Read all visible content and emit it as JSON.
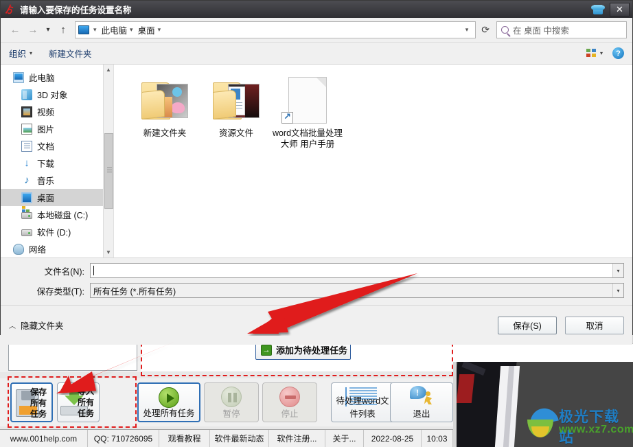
{
  "dialog": {
    "title": "请输入要保存的任务设置名称",
    "close_label": "✕",
    "titlebar_icon": "app-icon",
    "shirt_icon": "shirt-icon"
  },
  "nav": {
    "back_icon": "←",
    "forward_icon": "→",
    "recent_icon": "▾",
    "up_icon": "↑",
    "refresh_icon": "⟳",
    "address": {
      "pc_icon": "computer-icon",
      "crumbs": [
        "此电脑",
        "桌面"
      ],
      "dropdown_icon": "▾"
    },
    "search": {
      "placeholder": "在 桌面 中搜索",
      "icon": "search-icon"
    }
  },
  "command_bar": {
    "organize": "组织",
    "new_folder": "新建文件夹",
    "caret": "▾",
    "view_icon": "view-layout-icon",
    "help_icon": "?"
  },
  "sidebar": {
    "items": [
      {
        "label": "此电脑",
        "icon": "pc",
        "level": 1,
        "state": ""
      },
      {
        "label": "3D 对象",
        "icon": "d3",
        "level": 2,
        "state": ""
      },
      {
        "label": "视频",
        "icon": "vid",
        "level": 2,
        "state": ""
      },
      {
        "label": "图片",
        "icon": "pic",
        "level": 2,
        "state": ""
      },
      {
        "label": "文档",
        "icon": "doc",
        "level": 2,
        "state": ""
      },
      {
        "label": "下载",
        "icon": "dl",
        "level": 2,
        "state": ""
      },
      {
        "label": "音乐",
        "icon": "mus",
        "level": 2,
        "state": ""
      },
      {
        "label": "桌面",
        "icon": "dsk",
        "level": 2,
        "state": "selected2"
      },
      {
        "label": "本地磁盘 (C:)",
        "icon": "drvc",
        "level": 2,
        "state": ""
      },
      {
        "label": "软件 (D:)",
        "icon": "drv",
        "level": 2,
        "state": ""
      },
      {
        "label": "网络",
        "icon": "net",
        "level": 1,
        "state": ""
      }
    ],
    "scroll_up_icon": "▲",
    "scroll_down_icon": "▼"
  },
  "files": [
    {
      "name": "新建文件夹",
      "type": "folder"
    },
    {
      "name": "资源文件",
      "type": "folder"
    },
    {
      "name": "word文档批量处理大师 用户手册",
      "type": "shortcut"
    }
  ],
  "form": {
    "filename_label": "文件名(N):",
    "filename_value": "",
    "savetype_label": "保存类型(T):",
    "savetype_value": "所有任务 (*.所有任务)",
    "dropdown_icon": "▾"
  },
  "footer": {
    "hide_folders": "隐藏文件夹",
    "collapse_icon": "︿",
    "save_button": "保存(S)",
    "cancel_button": "取消"
  },
  "app": {
    "add_pending_button": "添加为待处理任务",
    "add_pending_icon": "→",
    "buttons": [
      {
        "name": "save-all",
        "vertical": [
          "保存",
          "所有",
          "任务"
        ],
        "horizontal": "",
        "icon": "floppy",
        "state": "sel"
      },
      {
        "name": "import-all",
        "vertical": [
          "导入",
          "所有",
          "任务"
        ],
        "horizontal": "",
        "icon": "download",
        "state": ""
      },
      {
        "name": "process-all",
        "vertical": [],
        "horizontal": "处理所有任务",
        "icon": "play",
        "state": "sel"
      },
      {
        "name": "pause",
        "vertical": [],
        "horizontal": "暂停",
        "icon": "pause",
        "state": "dis"
      },
      {
        "name": "stop",
        "vertical": [],
        "horizontal": "停止",
        "icon": "stop",
        "state": "dis"
      },
      {
        "name": "pending-list",
        "vertical": [],
        "horizontal": "待处理word文件列表",
        "icon": "doclines",
        "state": ""
      },
      {
        "name": "exit",
        "vertical": [],
        "horizontal": "退出",
        "icon": "runman",
        "state": ""
      }
    ],
    "statusbar": [
      "www.001help.com",
      "QQ: 710726095",
      "观看教程",
      "软件最新动态",
      "软件注册...",
      "关于...",
      "2022-08-25",
      "10:03"
    ]
  },
  "watermark": {
    "title": "极光下载站",
    "url": "www.xz7.com"
  },
  "colors": {
    "accent": "#2f6fb5",
    "annotation": "#e01b1b",
    "title_bg": "#3a3a3f"
  }
}
